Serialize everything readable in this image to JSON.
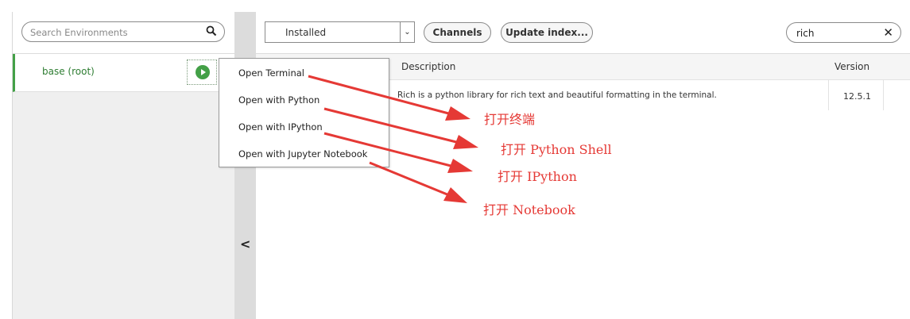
{
  "sidebar": {
    "search_placeholder": "Search Environments",
    "search_icon": "magnifier-icon",
    "environments": [
      {
        "label": "base (root)",
        "run_icon": "play-circle-icon"
      }
    ],
    "collapse_icon": "chevron-left-icon",
    "collapse_label": "<"
  },
  "toolbar": {
    "filter_value": "Installed",
    "filter_arrow": "⌄",
    "channels_label": "Channels",
    "update_index_label": "Update index...",
    "search_value": "rich",
    "clear_label": "✕"
  },
  "table": {
    "columns": {
      "description": "Description",
      "version": "Version"
    },
    "rows": [
      {
        "description": "Rich is a python library for rich text and beautiful formatting in the terminal.",
        "version": "12.5.1"
      }
    ]
  },
  "context_menu": {
    "items": [
      "Open Terminal",
      "Open with Python",
      "Open with IPython",
      "Open with Jupyter Notebook"
    ]
  },
  "annotations": {
    "color": "#e53935",
    "labels": [
      "打开终端",
      "打开 Python Shell",
      "打开 IPython",
      "打开 Notebook"
    ]
  },
  "colors": {
    "accent_green": "#43a047",
    "env_text": "#2e7d32"
  }
}
